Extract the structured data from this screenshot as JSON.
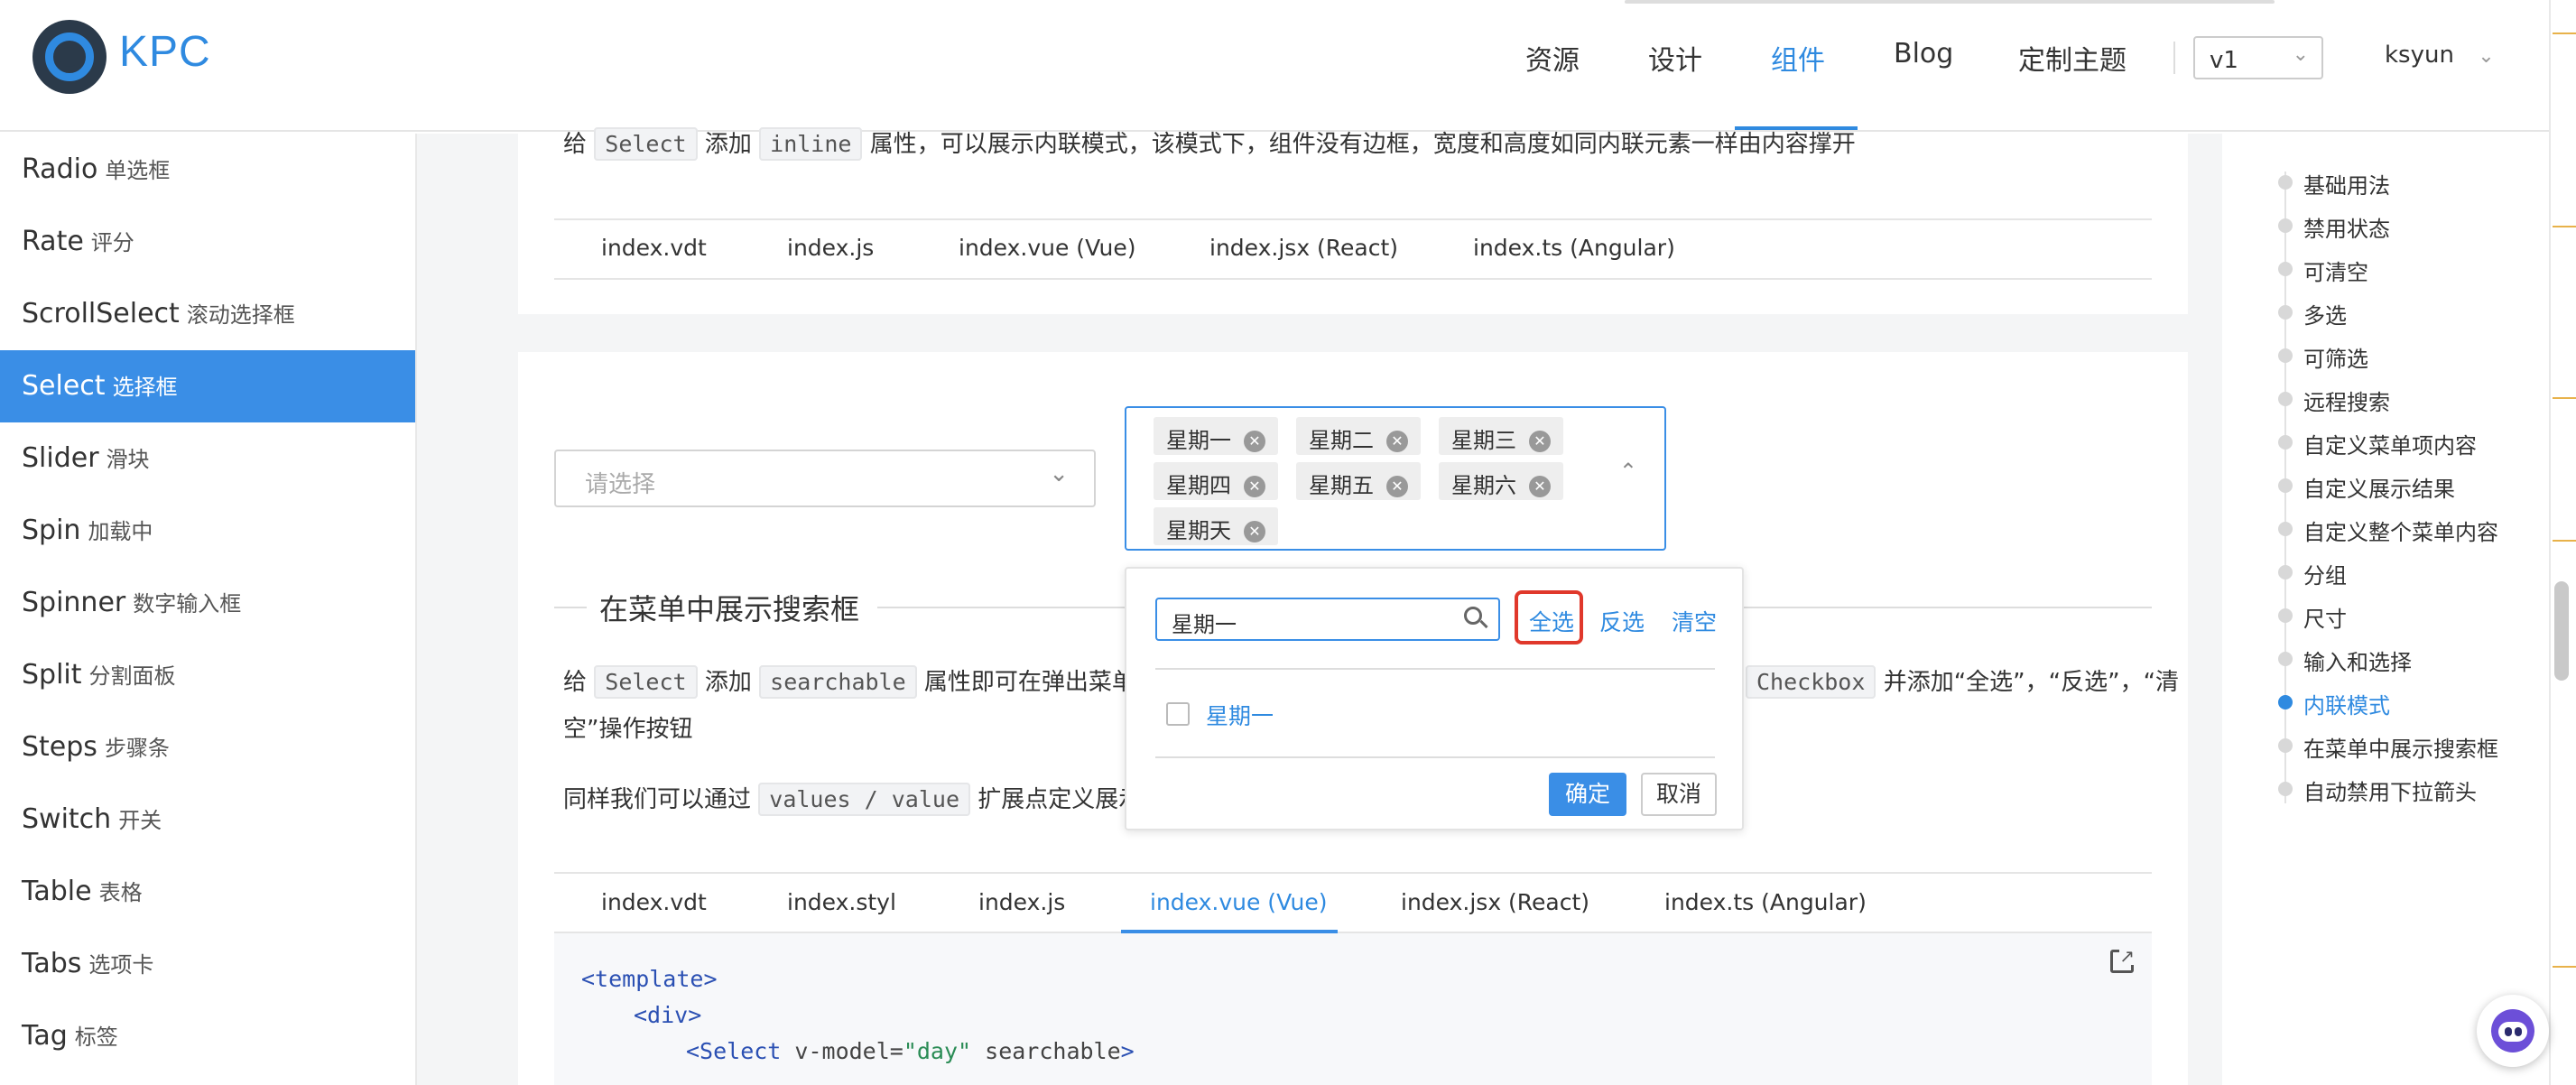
{
  "header": {
    "logo_text": "KPC",
    "nav": [
      "资源",
      "设计",
      "组件",
      "Blog",
      "定制主题"
    ],
    "active_nav": "组件",
    "version": "v1",
    "user": "ksyun"
  },
  "sidebar": {
    "items": [
      {
        "en": "Radio",
        "cn": "单选框"
      },
      {
        "en": "Rate",
        "cn": "评分"
      },
      {
        "en": "ScrollSelect",
        "cn": "滚动选择框"
      },
      {
        "en": "Select",
        "cn": "选择框"
      },
      {
        "en": "Slider",
        "cn": "滑块"
      },
      {
        "en": "Spin",
        "cn": "加载中"
      },
      {
        "en": "Spinner",
        "cn": "数字输入框"
      },
      {
        "en": "Split",
        "cn": "分割面板"
      },
      {
        "en": "Steps",
        "cn": "步骤条"
      },
      {
        "en": "Switch",
        "cn": "开关"
      },
      {
        "en": "Table",
        "cn": "表格"
      },
      {
        "en": "Tabs",
        "cn": "选项卡"
      },
      {
        "en": "Tag",
        "cn": "标签"
      }
    ],
    "active": "Select"
  },
  "inline_section": {
    "desc": {
      "p1": "给",
      "code1": "Select",
      "p2": "添加",
      "code2": "inline",
      "p3": "属性，可以展示内联模式，该模式下，组件没有边框，宽度和高度如同内联元素一样由内容撑开"
    },
    "tabs": [
      "index.vdt",
      "index.js",
      "index.vue (Vue)",
      "index.jsx (React)",
      "index.ts (Angular)"
    ]
  },
  "demo": {
    "select_placeholder": "请选择",
    "tags": [
      "星期一",
      "星期二",
      "星期三",
      "星期四",
      "星期五",
      "星期六",
      "星期天"
    ],
    "dropdown": {
      "search_value": "星期一",
      "select_all": "全选",
      "invert": "反选",
      "clear": "清空",
      "option": "星期一",
      "confirm": "确定",
      "cancel": "取消"
    }
  },
  "search_section": {
    "title": "在菜单中展示搜索框",
    "desc1": {
      "p1": "给",
      "code1": "Select",
      "p2": "添加",
      "code2": "searchable",
      "p3": "属性即可在弹出菜单中",
      "code3": "Checkbox",
      "p4": "并添加“全选”，“反选”，“清",
      "p5": "空”操作按钮"
    },
    "desc2": {
      "p1": "同样我们可以通过",
      "code1": "values / value",
      "p2": "扩展点定义展示的"
    },
    "tabs": [
      "index.vdt",
      "index.styl",
      "index.js",
      "index.vue (Vue)",
      "index.jsx (React)",
      "index.ts (Angular)"
    ],
    "active_tab": "index.vue (Vue)",
    "code": {
      "l1": "<template>",
      "l2": "<div>",
      "l3_tag": "<Select",
      "l3_attr1": " v-model=",
      "l3_str": "\"day\"",
      "l3_attr2": " searchable",
      "l3_end": ">"
    }
  },
  "toc": {
    "items": [
      "基础用法",
      "禁用状态",
      "可清空",
      "多选",
      "可筛选",
      "远程搜索",
      "自定义菜单项内容",
      "自定义展示结果",
      "自定义整个菜单内容",
      "分组",
      "尺寸",
      "输入和选择",
      "内联模式",
      "在菜单中展示搜索框",
      "自动禁用下拉箭头"
    ],
    "active": "内联模式"
  },
  "colors": {
    "accent": "#3a8ee6",
    "highlight_border": "#e0382b"
  },
  "icons": [
    "logo-icon",
    "chevron-down-icon",
    "chevron-up-icon",
    "close-circle-icon",
    "search-icon",
    "open-in-new-icon",
    "assistant-bot-icon"
  ]
}
